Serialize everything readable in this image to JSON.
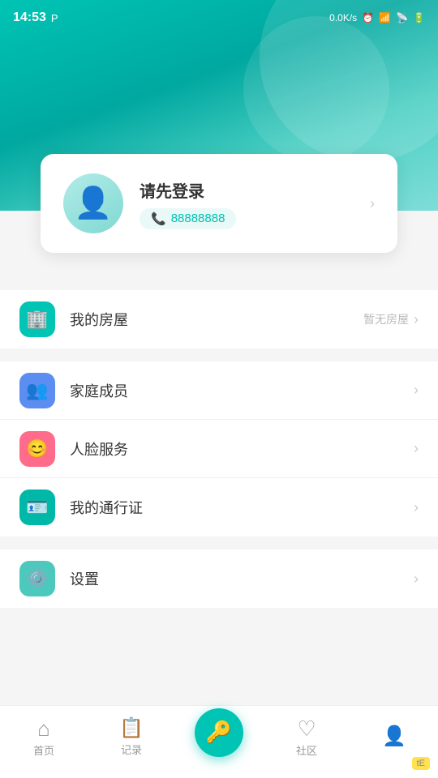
{
  "statusBar": {
    "time": "14:53",
    "network": "0.0K/s",
    "carrier": "P"
  },
  "header": {
    "bgColor": "#00c4b4"
  },
  "profileCard": {
    "loginPrompt": "请先登录",
    "phone": "88888888",
    "arrowLabel": "›"
  },
  "menuSections": [
    {
      "items": [
        {
          "id": "my-house",
          "label": "我的房屋",
          "hint": "暂无房屋",
          "iconType": "green",
          "iconSymbol": "🏢"
        }
      ]
    },
    {
      "items": [
        {
          "id": "family-members",
          "label": "家庭成员",
          "hint": "",
          "iconType": "blue",
          "iconSymbol": "👥"
        },
        {
          "id": "face-service",
          "label": "人脸服务",
          "hint": "",
          "iconType": "pink",
          "iconSymbol": "😊"
        },
        {
          "id": "my-pass",
          "label": "我的通行证",
          "hint": "",
          "iconType": "teal",
          "iconSymbol": "🪪"
        }
      ]
    },
    {
      "items": [
        {
          "id": "settings",
          "label": "设置",
          "hint": "",
          "iconType": "mint",
          "iconSymbol": "⚙️"
        }
      ]
    }
  ],
  "bottomNav": [
    {
      "id": "home",
      "label": "首页",
      "symbol": "⌂",
      "active": false
    },
    {
      "id": "records",
      "label": "记录",
      "symbol": "📋",
      "active": false
    },
    {
      "id": "lock",
      "label": "",
      "symbol": "🔑",
      "active": false,
      "isCenter": true
    },
    {
      "id": "community",
      "label": "社区",
      "symbol": "♡",
      "active": false
    },
    {
      "id": "profile",
      "label": "",
      "symbol": "👤",
      "active": true
    }
  ],
  "watermark": {
    "text": "tE"
  }
}
